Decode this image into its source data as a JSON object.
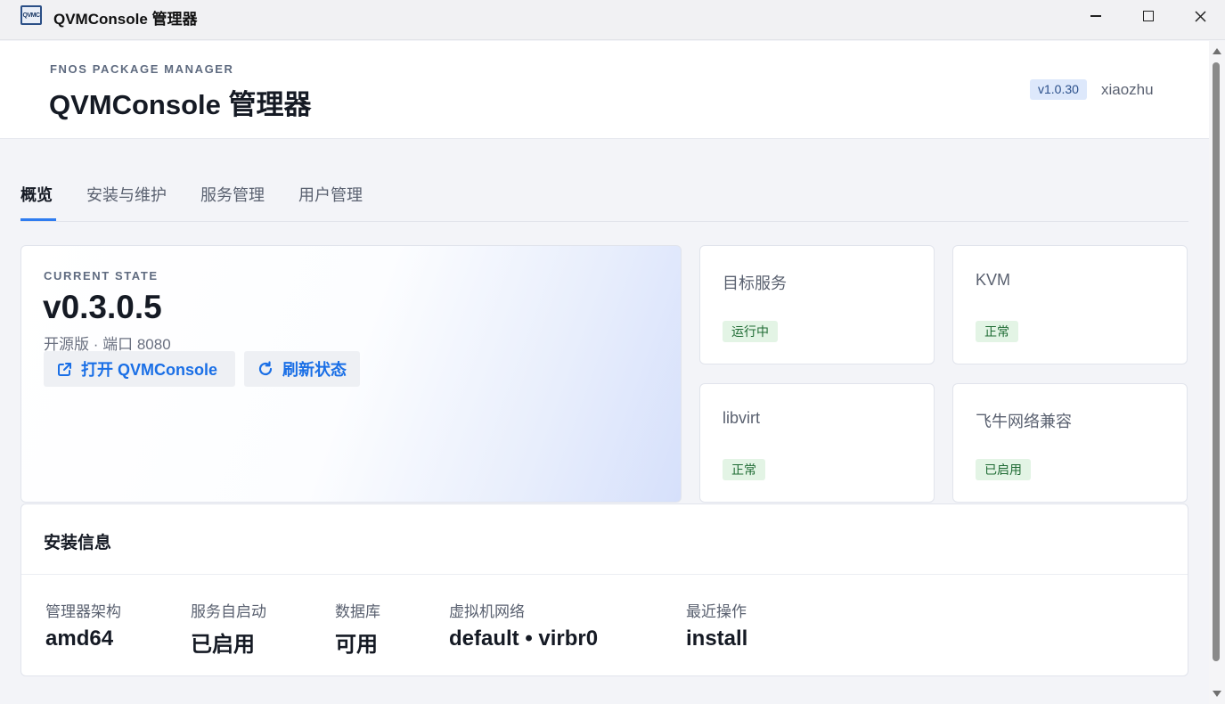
{
  "window": {
    "title": "QVMConsole 管理器",
    "icon_text": "QVMC"
  },
  "header": {
    "eyebrow": "FNOS PACKAGE MANAGER",
    "title": "QVMConsole 管理器",
    "version": "v1.0.30",
    "user": "xiaozhu"
  },
  "tabs": [
    {
      "label": "概览",
      "active": true
    },
    {
      "label": "安装与维护",
      "active": false
    },
    {
      "label": "服务管理",
      "active": false
    },
    {
      "label": "用户管理",
      "active": false
    }
  ],
  "hero": {
    "eyebrow": "CURRENT STATE",
    "version": "v0.3.0.5",
    "subtitle": "开源版 · 端口 8080",
    "open_label": "打开 QVMConsole",
    "refresh_label": "刷新状态"
  },
  "status_cards": [
    {
      "name": "目标服务",
      "status": "运行中"
    },
    {
      "name": "KVM",
      "status": "正常"
    },
    {
      "name": "libvirt",
      "status": "正常"
    },
    {
      "name": "飞牛网络兼容",
      "status": "已启用"
    }
  ],
  "install_info": {
    "title": "安装信息",
    "items": [
      {
        "label": "管理器架构",
        "value": "amd64"
      },
      {
        "label": "服务自启动",
        "value": "已启用"
      },
      {
        "label": "数据库",
        "value": "可用"
      },
      {
        "label": "虚拟机网络",
        "value": "default • virbr0"
      },
      {
        "label": "最近操作",
        "value": "install"
      }
    ]
  },
  "colors": {
    "accent": "#2f7cf0",
    "link": "#1a6fe6",
    "status_bg": "#e3f4e5",
    "status_fg": "#1f6b34",
    "version_badge_bg": "#dde8fb"
  }
}
